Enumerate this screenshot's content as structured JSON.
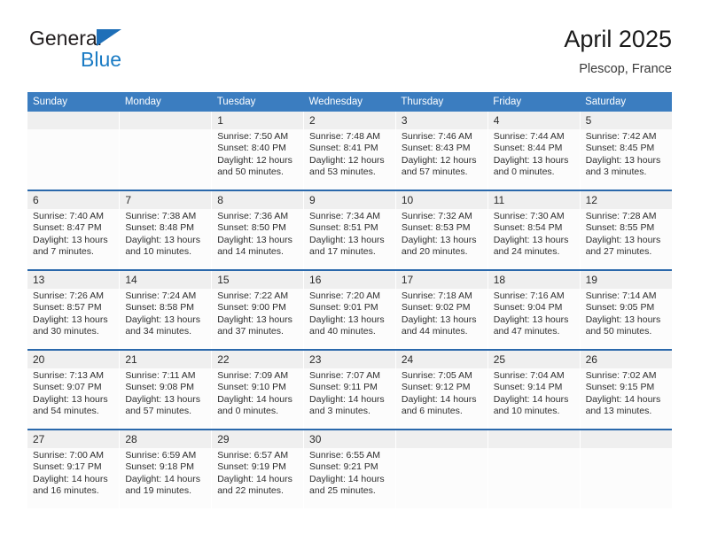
{
  "brand": {
    "name_top": "General",
    "name_bottom": "Blue",
    "triangle_color": "#1e6fb8",
    "blue_color": "#1a7bc4"
  },
  "header": {
    "title": "April 2025",
    "location": "Plescop, France"
  },
  "theme": {
    "header_bg": "#3b7dc0",
    "row_divider": "#2a68ab",
    "daynum_bg": "#efefef",
    "cell_bg": "#fcfcfc"
  },
  "weekdays": [
    "Sunday",
    "Monday",
    "Tuesday",
    "Wednesday",
    "Thursday",
    "Friday",
    "Saturday"
  ],
  "weeks": [
    [
      {
        "day": "",
        "lines": []
      },
      {
        "day": "",
        "lines": []
      },
      {
        "day": "1",
        "lines": [
          "Sunrise: 7:50 AM",
          "Sunset: 8:40 PM",
          "Daylight: 12 hours",
          "and 50 minutes."
        ]
      },
      {
        "day": "2",
        "lines": [
          "Sunrise: 7:48 AM",
          "Sunset: 8:41 PM",
          "Daylight: 12 hours",
          "and 53 minutes."
        ]
      },
      {
        "day": "3",
        "lines": [
          "Sunrise: 7:46 AM",
          "Sunset: 8:43 PM",
          "Daylight: 12 hours",
          "and 57 minutes."
        ]
      },
      {
        "day": "4",
        "lines": [
          "Sunrise: 7:44 AM",
          "Sunset: 8:44 PM",
          "Daylight: 13 hours",
          "and 0 minutes."
        ]
      },
      {
        "day": "5",
        "lines": [
          "Sunrise: 7:42 AM",
          "Sunset: 8:45 PM",
          "Daylight: 13 hours",
          "and 3 minutes."
        ]
      }
    ],
    [
      {
        "day": "6",
        "lines": [
          "Sunrise: 7:40 AM",
          "Sunset: 8:47 PM",
          "Daylight: 13 hours",
          "and 7 minutes."
        ]
      },
      {
        "day": "7",
        "lines": [
          "Sunrise: 7:38 AM",
          "Sunset: 8:48 PM",
          "Daylight: 13 hours",
          "and 10 minutes."
        ]
      },
      {
        "day": "8",
        "lines": [
          "Sunrise: 7:36 AM",
          "Sunset: 8:50 PM",
          "Daylight: 13 hours",
          "and 14 minutes."
        ]
      },
      {
        "day": "9",
        "lines": [
          "Sunrise: 7:34 AM",
          "Sunset: 8:51 PM",
          "Daylight: 13 hours",
          "and 17 minutes."
        ]
      },
      {
        "day": "10",
        "lines": [
          "Sunrise: 7:32 AM",
          "Sunset: 8:53 PM",
          "Daylight: 13 hours",
          "and 20 minutes."
        ]
      },
      {
        "day": "11",
        "lines": [
          "Sunrise: 7:30 AM",
          "Sunset: 8:54 PM",
          "Daylight: 13 hours",
          "and 24 minutes."
        ]
      },
      {
        "day": "12",
        "lines": [
          "Sunrise: 7:28 AM",
          "Sunset: 8:55 PM",
          "Daylight: 13 hours",
          "and 27 minutes."
        ]
      }
    ],
    [
      {
        "day": "13",
        "lines": [
          "Sunrise: 7:26 AM",
          "Sunset: 8:57 PM",
          "Daylight: 13 hours",
          "and 30 minutes."
        ]
      },
      {
        "day": "14",
        "lines": [
          "Sunrise: 7:24 AM",
          "Sunset: 8:58 PM",
          "Daylight: 13 hours",
          "and 34 minutes."
        ]
      },
      {
        "day": "15",
        "lines": [
          "Sunrise: 7:22 AM",
          "Sunset: 9:00 PM",
          "Daylight: 13 hours",
          "and 37 minutes."
        ]
      },
      {
        "day": "16",
        "lines": [
          "Sunrise: 7:20 AM",
          "Sunset: 9:01 PM",
          "Daylight: 13 hours",
          "and 40 minutes."
        ]
      },
      {
        "day": "17",
        "lines": [
          "Sunrise: 7:18 AM",
          "Sunset: 9:02 PM",
          "Daylight: 13 hours",
          "and 44 minutes."
        ]
      },
      {
        "day": "18",
        "lines": [
          "Sunrise: 7:16 AM",
          "Sunset: 9:04 PM",
          "Daylight: 13 hours",
          "and 47 minutes."
        ]
      },
      {
        "day": "19",
        "lines": [
          "Sunrise: 7:14 AM",
          "Sunset: 9:05 PM",
          "Daylight: 13 hours",
          "and 50 minutes."
        ]
      }
    ],
    [
      {
        "day": "20",
        "lines": [
          "Sunrise: 7:13 AM",
          "Sunset: 9:07 PM",
          "Daylight: 13 hours",
          "and 54 minutes."
        ]
      },
      {
        "day": "21",
        "lines": [
          "Sunrise: 7:11 AM",
          "Sunset: 9:08 PM",
          "Daylight: 13 hours",
          "and 57 minutes."
        ]
      },
      {
        "day": "22",
        "lines": [
          "Sunrise: 7:09 AM",
          "Sunset: 9:10 PM",
          "Daylight: 14 hours",
          "and 0 minutes."
        ]
      },
      {
        "day": "23",
        "lines": [
          "Sunrise: 7:07 AM",
          "Sunset: 9:11 PM",
          "Daylight: 14 hours",
          "and 3 minutes."
        ]
      },
      {
        "day": "24",
        "lines": [
          "Sunrise: 7:05 AM",
          "Sunset: 9:12 PM",
          "Daylight: 14 hours",
          "and 6 minutes."
        ]
      },
      {
        "day": "25",
        "lines": [
          "Sunrise: 7:04 AM",
          "Sunset: 9:14 PM",
          "Daylight: 14 hours",
          "and 10 minutes."
        ]
      },
      {
        "day": "26",
        "lines": [
          "Sunrise: 7:02 AM",
          "Sunset: 9:15 PM",
          "Daylight: 14 hours",
          "and 13 minutes."
        ]
      }
    ],
    [
      {
        "day": "27",
        "lines": [
          "Sunrise: 7:00 AM",
          "Sunset: 9:17 PM",
          "Daylight: 14 hours",
          "and 16 minutes."
        ]
      },
      {
        "day": "28",
        "lines": [
          "Sunrise: 6:59 AM",
          "Sunset: 9:18 PM",
          "Daylight: 14 hours",
          "and 19 minutes."
        ]
      },
      {
        "day": "29",
        "lines": [
          "Sunrise: 6:57 AM",
          "Sunset: 9:19 PM",
          "Daylight: 14 hours",
          "and 22 minutes."
        ]
      },
      {
        "day": "30",
        "lines": [
          "Sunrise: 6:55 AM",
          "Sunset: 9:21 PM",
          "Daylight: 14 hours",
          "and 25 minutes."
        ]
      },
      {
        "day": "",
        "lines": []
      },
      {
        "day": "",
        "lines": []
      },
      {
        "day": "",
        "lines": []
      }
    ]
  ]
}
